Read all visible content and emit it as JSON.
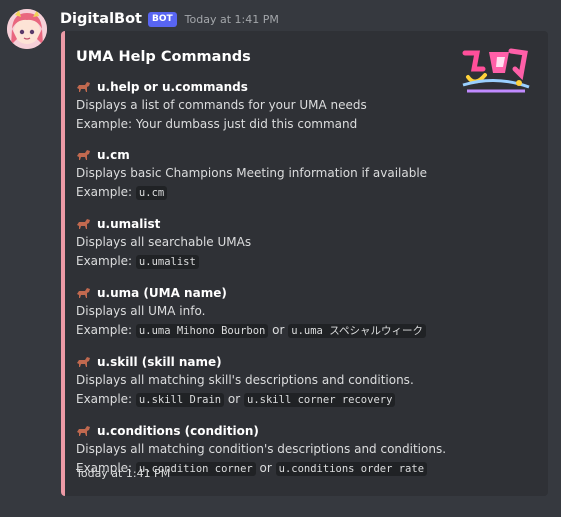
{
  "message": {
    "username": "DigitalBot",
    "badge": "BOT",
    "timestamp": "Today at 1:41 PM"
  },
  "colors": {
    "embed_accent": "#ec9aa6",
    "background": "#36393f",
    "embed_background": "#2f3136",
    "bot_badge": "#5865f2"
  },
  "embed": {
    "title": "UMA Help Commands",
    "thumbnail_icon": "uma-musume-logo",
    "footer": "Today at 1:41 PM",
    "commands": [
      {
        "icon": "horse-icon",
        "name": "u.help or u.commands",
        "description": "Displays a list of commands for your UMA needs",
        "example_prefix": "Example: Your dumbass just did this command"
      },
      {
        "icon": "horse-icon",
        "name": "u.cm",
        "description": "Displays basic Champions Meeting information if available",
        "example_prefix": "Example: ",
        "code1": "u.cm"
      },
      {
        "icon": "horse-icon",
        "name": "u.umalist",
        "description": "Displays all searchable UMAs",
        "example_prefix": "Example: ",
        "code1": "u.umalist"
      },
      {
        "icon": "horse-icon",
        "name": "u.uma (UMA name)",
        "description": "Displays all UMA info.",
        "example_prefix": "Example: ",
        "code1": "u.uma Mihono Bourbon",
        "or": " or ",
        "code2": "u.uma スペシャルウィーク"
      },
      {
        "icon": "horse-icon",
        "name": "u.skill (skill name)",
        "description": "Displays all matching skill's descriptions and conditions.",
        "example_prefix": "Example: ",
        "code1": "u.skill Drain",
        "or": " or ",
        "code2": "u.skill corner recovery"
      },
      {
        "icon": "horse-icon",
        "name": "u.conditions (condition)",
        "description": "Displays all matching condition's descriptions and conditions.",
        "example_prefix": "Example: ",
        "code1": "u.condition corner",
        "or": " or ",
        "code2": "u.conditions order rate"
      }
    ]
  }
}
